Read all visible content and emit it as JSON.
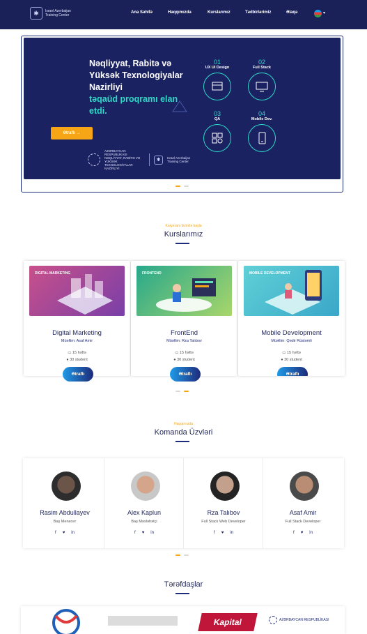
{
  "header": {
    "logo_text": "Israel Azerbaijan Training Center",
    "nav": [
      "Ana Səhifə",
      "Haqqımızda",
      "Kurslarımız",
      "Tədbirlərimiz",
      "Əlaqə"
    ]
  },
  "hero": {
    "title": "Nəqliyyat, Rabitə və Yüksək Texnologiyalar Nazirliyi",
    "subtitle": "təqaüd proqramı elan etdi.",
    "button": "Ətraflı →",
    "ministry_text": "AZƏRBAYCAN RESPUBLİKASI NƏQLİYYAT, RABİTƏ VƏ YÜKSƏK TEXNOLOGİYALAR NAZİRLİYİ",
    "center_text": "Israel Azerbaijan Training Center",
    "courses": [
      {
        "num": "01",
        "name": "UX UI Design"
      },
      {
        "num": "02",
        "name": "Full Stack"
      },
      {
        "num": "03",
        "name": "QA"
      },
      {
        "num": "04",
        "name": "Mobile Dev."
      }
    ]
  },
  "courses_section": {
    "kicker": "Karyeranı bizimlə başla",
    "title": "Kurslarımız",
    "cards": [
      {
        "image_label": "DIGITAL MARKETING",
        "title": "Digital Marketing",
        "teacher": "Müəllim: Asaf Amir",
        "duration": "15 həftə",
        "students": "30 student",
        "button": "Ətraflı"
      },
      {
        "image_label": "FRONTEND",
        "title": "FrontEnd",
        "teacher": "Müəllim: Rza Talıbov",
        "duration": "15 həftə",
        "students": "30 student",
        "button": "Ətraflı"
      },
      {
        "image_label": "MOBILE DEVELOPMENT",
        "title": "Mobile Development",
        "teacher": "Müəllim: Qədir Rüstəmli",
        "duration": "15 həftə",
        "students": "30 student",
        "button": "Ətraflı"
      }
    ]
  },
  "team_section": {
    "kicker": "Haqqımızda",
    "title": "Komanda Üzvləri",
    "members": [
      {
        "name": "Rasim Abdullayev",
        "role": "Baş Menecer"
      },
      {
        "name": "Alex Kaplun",
        "role": "Baş Məsləhətçi"
      },
      {
        "name": "Rza Talıbov",
        "role": "Full Stack Web Developer"
      },
      {
        "name": "Asaf Amir",
        "role": "Full Stack Developer"
      }
    ],
    "social": [
      "f",
      "t",
      "in"
    ]
  },
  "partners_section": {
    "title": "Tərəfdaşlar",
    "logos": [
      "Kapital",
      "AZƏRBAYCAN RESPUBLİKASI"
    ]
  },
  "colors": {
    "navy": "#1a2159",
    "accent": "#f5a516",
    "teal": "#2fd9c6"
  }
}
